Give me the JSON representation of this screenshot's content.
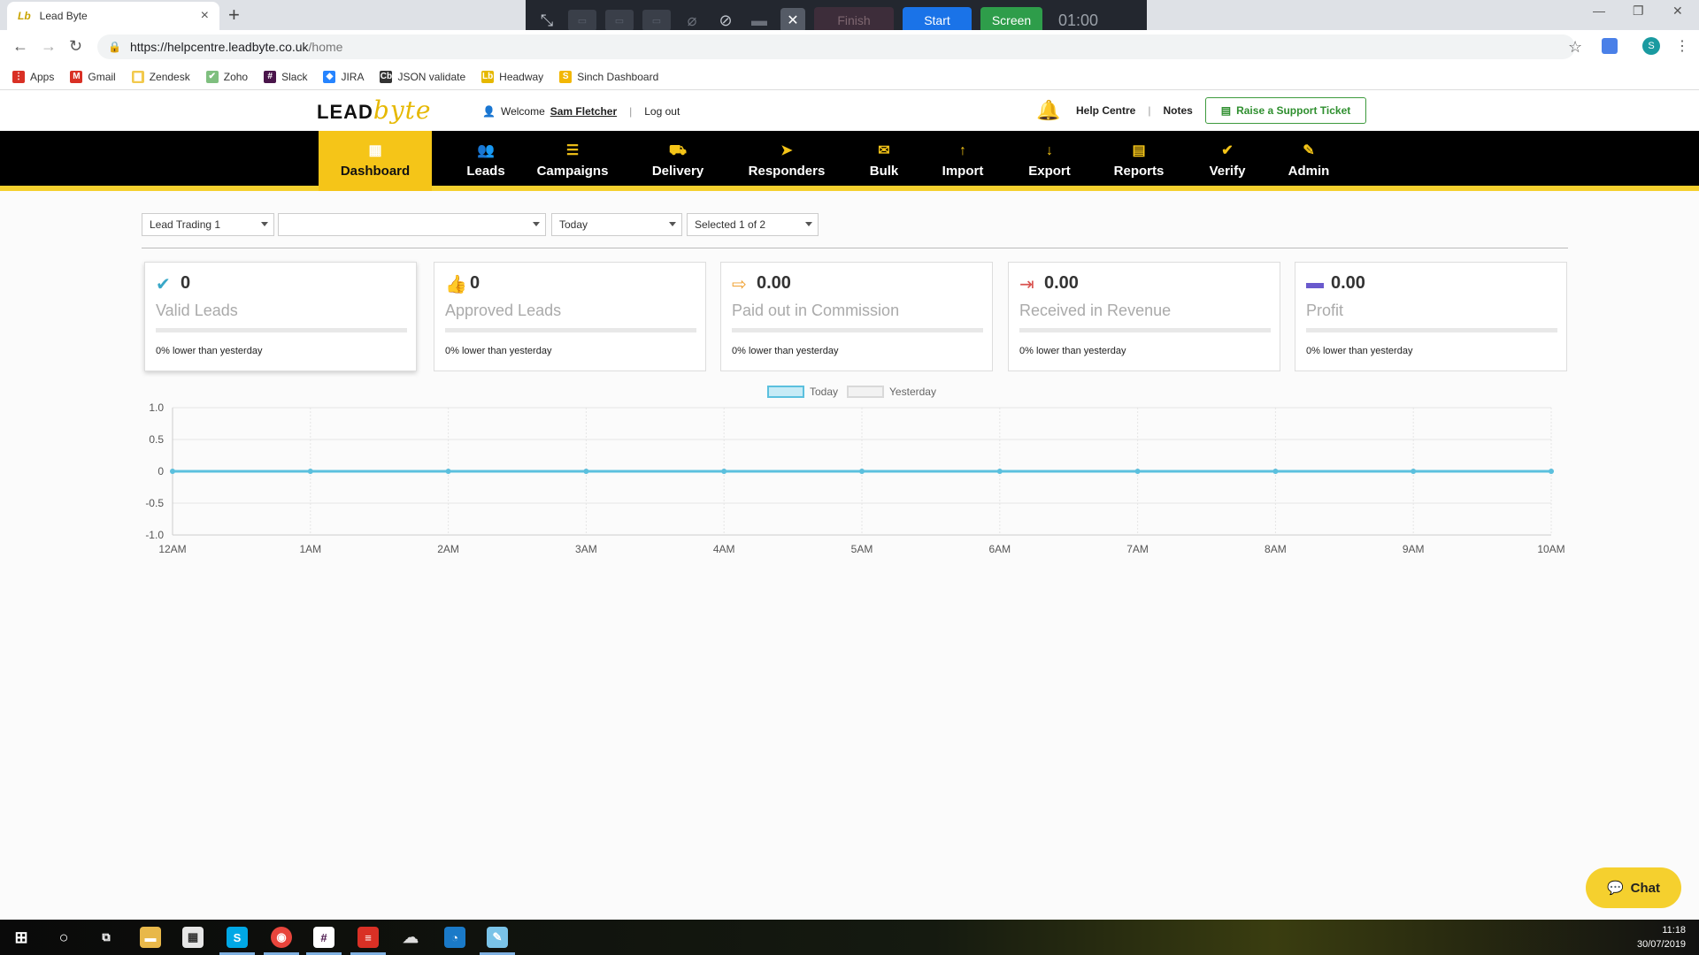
{
  "browser": {
    "tab_title": "Lead Byte",
    "tab_favicon": "Lb",
    "url_host": "https://helpcentre.leadbyte.co.uk",
    "url_path": "/home",
    "profile_initial": "S",
    "bookmarks": [
      {
        "label": "Apps",
        "icon": "apps-grid-icon",
        "color": "#d93025"
      },
      {
        "label": "Gmail",
        "icon": "gmail-icon",
        "color": "#d93025"
      },
      {
        "label": "Zendesk",
        "icon": "folder-icon",
        "color": "#f2c94c"
      },
      {
        "label": "Zoho",
        "icon": "zoho-icon",
        "color": "#7fbf7f"
      },
      {
        "label": "Slack",
        "icon": "slack-icon",
        "color": "#4a154b"
      },
      {
        "label": "JIRA",
        "icon": "jira-icon",
        "color": "#2684ff"
      },
      {
        "label": "JSON validate",
        "icon": "cb-icon",
        "color": "#333333"
      },
      {
        "label": "Headway",
        "icon": "headway-icon",
        "color": "#e6b800"
      },
      {
        "label": "Sinch Dashboard",
        "icon": "sinch-icon",
        "color": "#f2b705"
      }
    ]
  },
  "recorder": {
    "finish_label": "Finish",
    "start_label": "Start",
    "screen_label": "Screen",
    "timer": "01:00"
  },
  "header": {
    "logo_lead": "LEAD",
    "logo_byte": "byte",
    "welcome_label": "Welcome",
    "user_name": "Sam Fletcher",
    "logout_label": "Log out",
    "help_centre_label": "Help Centre",
    "notes_label": "Notes",
    "ticket_label": "Raise a Support Ticket"
  },
  "nav": [
    {
      "label": "Dashboard",
      "icon": "dashboard-grid-icon",
      "active": true
    },
    {
      "label": "Leads",
      "icon": "users-icon"
    },
    {
      "label": "Campaigns",
      "icon": "database-icon"
    },
    {
      "label": "Delivery",
      "icon": "truck-icon"
    },
    {
      "label": "Responders",
      "icon": "paper-plane-icon"
    },
    {
      "label": "Bulk",
      "icon": "bulk-mail-icon"
    },
    {
      "label": "Import",
      "icon": "arrow-up-icon"
    },
    {
      "label": "Export",
      "icon": "arrow-down-icon"
    },
    {
      "label": "Reports",
      "icon": "report-file-icon"
    },
    {
      "label": "Verify",
      "icon": "check-circle-icon"
    },
    {
      "label": "Admin",
      "icon": "edit-icon"
    }
  ],
  "filters": {
    "account": "Lead Trading 1",
    "secondary": "",
    "period": "Today",
    "selection": "Selected 1 of 2"
  },
  "cards": [
    {
      "value": "0",
      "label": "Valid Leads",
      "compare": "0% lower than yesterday",
      "icon": "check-icon",
      "color": "#3aa8c8"
    },
    {
      "value": "0",
      "label": "Approved Leads",
      "compare": "0% lower than yesterday",
      "icon": "thumbs-up-icon",
      "color": "#4caf50"
    },
    {
      "value": "0.00",
      "label": "Paid out in Commission",
      "compare": "0% lower than yesterday",
      "icon": "sign-out-icon",
      "color": "#f0a030"
    },
    {
      "value": "0.00",
      "label": "Received in Revenue",
      "compare": "0% lower than yesterday",
      "icon": "sign-in-icon",
      "color": "#d9534f"
    },
    {
      "value": "0.00",
      "label": "Profit",
      "compare": "0% lower than yesterday",
      "icon": "credit-card-icon",
      "color": "#6a5acd"
    }
  ],
  "chart_data": {
    "type": "line",
    "categories": [
      "12AM",
      "1AM",
      "2AM",
      "3AM",
      "4AM",
      "5AM",
      "6AM",
      "7AM",
      "8AM",
      "9AM",
      "10AM"
    ],
    "series": [
      {
        "name": "Today",
        "values": [
          0,
          0,
          0,
          0,
          0,
          0,
          0,
          0,
          0,
          0,
          0
        ],
        "color": "#5bc0de"
      },
      {
        "name": "Yesterday",
        "values": [
          0,
          0,
          0,
          0,
          0,
          0,
          0,
          0,
          0,
          0,
          0
        ],
        "color": "#d9d9d9"
      }
    ],
    "ylim": [
      -1.0,
      1.0
    ],
    "yticks": [
      "1.0",
      "0.5",
      "0",
      "-0.5",
      "-1.0"
    ],
    "grid": true,
    "legend": "top-center"
  },
  "chat": {
    "label": "Chat"
  },
  "taskbar": {
    "time": "11:18",
    "date": "30/07/2019"
  }
}
